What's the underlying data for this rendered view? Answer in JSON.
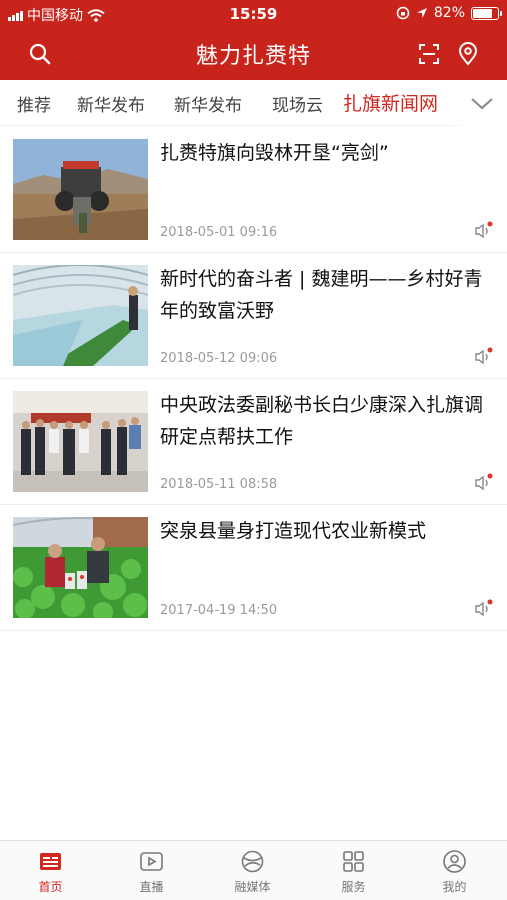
{
  "status_bar": {
    "carrier": "中国移动",
    "time": "15:59",
    "battery_percent": "82%",
    "battery_level": 0.82
  },
  "header": {
    "title": "魅力扎赉特",
    "search_icon": "search-icon",
    "scan_icon": "scan-icon",
    "location_icon": "location-pin-icon"
  },
  "tabs": [
    {
      "label": "推荐"
    },
    {
      "label": "新华发布"
    },
    {
      "label": "新华发布"
    },
    {
      "label": "现场云"
    },
    {
      "label": "扎旗新闻网"
    }
  ],
  "active_tab_index": 4,
  "news": [
    {
      "title": "扎赉特旗向毁林开垦“亮剑”",
      "date": "2018-05-01 09:16"
    },
    {
      "title": "新时代的奋斗者 | 魏建明——乡村好青年的致富沃野",
      "date": "2018-05-12 09:06"
    },
    {
      "title": "中央政法委副秘书长白少康深入扎旗调研定点帮扶工作",
      "date": "2018-05-11 08:58"
    },
    {
      "title": "突泉县量身打造现代农业新模式",
      "date": "2017-04-19 14:50"
    }
  ],
  "bottom_nav": [
    {
      "label": "首页",
      "icon": "home-news-icon"
    },
    {
      "label": "直播",
      "icon": "play-icon"
    },
    {
      "label": "融媒体",
      "icon": "globe-icon"
    },
    {
      "label": "服务",
      "icon": "grid-icon"
    },
    {
      "label": "我的",
      "icon": "user-icon"
    }
  ],
  "active_nav_index": 0,
  "colors": {
    "brand_red": "#c9241c",
    "active_red": "#d0281f",
    "date_gray": "#9a9a9a"
  }
}
